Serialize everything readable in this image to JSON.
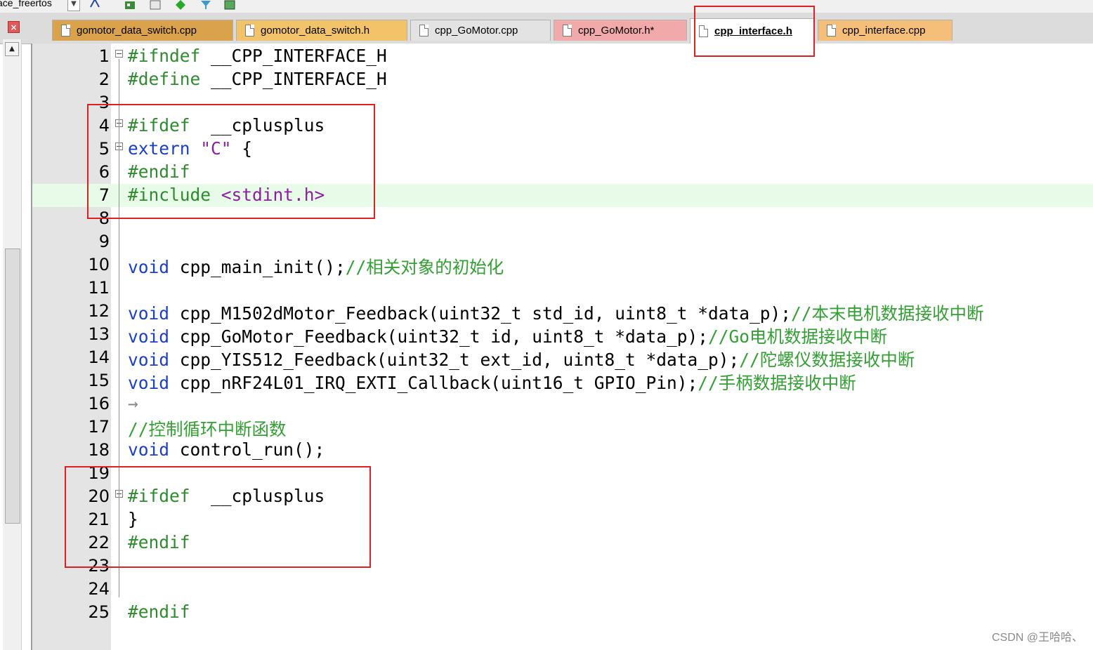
{
  "toolbar": {
    "project_target": "ace_freertos",
    "icons": [
      "dropdown-arrow-icon",
      "hierarchy-icon",
      "component-icon",
      "window-icon",
      "diamond-icon",
      "funnel-icon",
      "pack-installer-icon"
    ]
  },
  "tabs": [
    {
      "label": "gomotor_data_switch.cpp",
      "color": "#d9a24b",
      "active": false
    },
    {
      "label": "gomotor_data_switch.h",
      "color": "#f3c36a",
      "active": false
    },
    {
      "label": "cpp_GoMotor.cpp",
      "color": "#e3e3e3",
      "active": false
    },
    {
      "label": "cpp_GoMotor.h*",
      "color": "#f2a9a9",
      "active": false
    },
    {
      "label": "cpp_interface.h",
      "color": "#ffffff",
      "active": true
    },
    {
      "label": "cpp_interface.cpp",
      "color": "#f5bf7a",
      "active": false
    }
  ],
  "editor": {
    "lines": [
      {
        "n": "1",
        "fold": "⊟",
        "tokens": [
          {
            "c": "pp",
            "t": "#ifndef"
          },
          {
            "c": "",
            "t": " __CPP_INTERFACE_H"
          }
        ]
      },
      {
        "n": "2",
        "fold": "",
        "tokens": [
          {
            "c": "pp",
            "t": "#define"
          },
          {
            "c": "",
            "t": " __CPP_INTERFACE_H"
          }
        ]
      },
      {
        "n": "3",
        "fold": "",
        "tokens": []
      },
      {
        "n": "4",
        "fold": "⊟",
        "tokens": [
          {
            "c": "pp",
            "t": "#ifdef"
          },
          {
            "c": "",
            "t": "  __cplusplus"
          }
        ]
      },
      {
        "n": "5",
        "fold": "⊟",
        "tokens": [
          {
            "c": "kw",
            "t": "extern"
          },
          {
            "c": "",
            "t": " "
          },
          {
            "c": "str",
            "t": "\"C\""
          },
          {
            "c": "",
            "t": " {"
          }
        ]
      },
      {
        "n": "6",
        "fold": "",
        "tokens": [
          {
            "c": "pp",
            "t": "#endif"
          }
        ]
      },
      {
        "n": "7",
        "fold": "",
        "highlight": true,
        "tokens": [
          {
            "c": "pp",
            "t": "#include"
          },
          {
            "c": "",
            "t": " "
          },
          {
            "c": "str",
            "t": "<stdint.h>"
          }
        ]
      },
      {
        "n": "8",
        "fold": "",
        "tokens": []
      },
      {
        "n": "9",
        "fold": "",
        "tokens": []
      },
      {
        "n": "10",
        "fold": "",
        "tokens": [
          {
            "c": "kw",
            "t": "void"
          },
          {
            "c": "",
            "t": " cpp_main_init();"
          },
          {
            "c": "cmt",
            "t": "//相关对象的初始化"
          }
        ]
      },
      {
        "n": "11",
        "fold": "",
        "tokens": []
      },
      {
        "n": "12",
        "fold": "",
        "tokens": [
          {
            "c": "kw",
            "t": "void"
          },
          {
            "c": "",
            "t": " cpp_M1502dMotor_Feedback(uint32_t std_id, uint8_t *data_p);"
          },
          {
            "c": "cmt",
            "t": "//本末电机数据接收中断"
          }
        ]
      },
      {
        "n": "13",
        "fold": "",
        "tokens": [
          {
            "c": "kw",
            "t": "void"
          },
          {
            "c": "",
            "t": " cpp_GoMotor_Feedback(uint32_t id, uint8_t *data_p);"
          },
          {
            "c": "cmt",
            "t": "//Go电机数据接收中断"
          }
        ]
      },
      {
        "n": "14",
        "fold": "",
        "tokens": [
          {
            "c": "kw",
            "t": "void"
          },
          {
            "c": "",
            "t": " cpp_YIS512_Feedback(uint32_t ext_id, uint8_t *data_p);"
          },
          {
            "c": "cmt",
            "t": "//陀螺仪数据接收中断"
          }
        ]
      },
      {
        "n": "15",
        "fold": "",
        "tokens": [
          {
            "c": "kw",
            "t": "void"
          },
          {
            "c": "",
            "t": " cpp_nRF24L01_IRQ_EXTI_Callback(uint16_t GPIO_Pin);"
          },
          {
            "c": "cmt",
            "t": "//手柄数据接收中断"
          }
        ]
      },
      {
        "n": "16",
        "fold": "",
        "tokens": [
          {
            "c": "tabarrow",
            "t": "→"
          }
        ]
      },
      {
        "n": "17",
        "fold": "",
        "tokens": [
          {
            "c": "cmt",
            "t": "//控制循环中断函数"
          }
        ]
      },
      {
        "n": "18",
        "fold": "",
        "tokens": [
          {
            "c": "kw",
            "t": "void"
          },
          {
            "c": "",
            "t": " control_run();"
          }
        ]
      },
      {
        "n": "19",
        "fold": "",
        "tokens": []
      },
      {
        "n": "20",
        "fold": "⊟",
        "tokens": [
          {
            "c": "pp",
            "t": "#ifdef"
          },
          {
            "c": "",
            "t": "  __cplusplus"
          }
        ]
      },
      {
        "n": "21",
        "fold": "",
        "tokens": [
          {
            "c": "",
            "t": "}"
          }
        ]
      },
      {
        "n": "22",
        "fold": "",
        "tokens": [
          {
            "c": "pp",
            "t": "#endif"
          }
        ]
      },
      {
        "n": "23",
        "fold": "",
        "tokens": []
      },
      {
        "n": "24",
        "fold": "",
        "tokens": []
      },
      {
        "n": "25",
        "fold": "",
        "tokens": [
          {
            "c": "pp",
            "t": "#endif"
          }
        ]
      }
    ]
  },
  "watermark": "CSDN @王哈哈、",
  "colors": {
    "annotation_red": "#e02020",
    "highlight_line": "#e8fae8"
  }
}
